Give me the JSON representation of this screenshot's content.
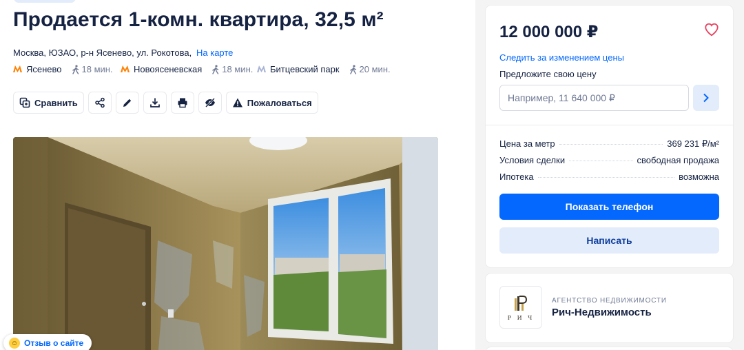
{
  "listing": {
    "title": "Продается 1-комн. квартира, 32,5 м²",
    "address": "Москва, ЮЗАО, р-н Ясенево, ул. Рокотова,",
    "map_link": "На карте",
    "metro": [
      {
        "name": "Ясенево",
        "time": "18 мин.",
        "color": "#ff8103"
      },
      {
        "name": "Новоясеневская",
        "time": "18 мин.",
        "color": "#ff8103"
      },
      {
        "name": "Битцевский парк",
        "time": "20 мин.",
        "color": "#a8b4d6"
      }
    ]
  },
  "toolbar": {
    "compare_label": "Сравнить",
    "complain_label": "Пожаловаться"
  },
  "feedback": {
    "label": "Отзыв о сайте"
  },
  "price_card": {
    "price": "12 000 000 ₽",
    "follow_label": "Следить за изменением цены",
    "offer_label": "Предложите свою цену",
    "offer_placeholder": "Например, 11 640 000 ₽",
    "details": [
      {
        "label": "Цена за метр",
        "value": "369 231 ₽/м²"
      },
      {
        "label": "Условия сделки",
        "value": "свободная продажа"
      },
      {
        "label": "Ипотека",
        "value": "возможна"
      }
    ],
    "show_phone_label": "Показать телефон",
    "write_label": "Написать"
  },
  "agency": {
    "logo_text": "Р И Ч",
    "type": "Агентство недвижимости",
    "name": "Рич-Недвижимость"
  },
  "colors": {
    "accent": "#0468ff",
    "accent_light": "#e3ecfb",
    "favorite": "#e84260"
  }
}
